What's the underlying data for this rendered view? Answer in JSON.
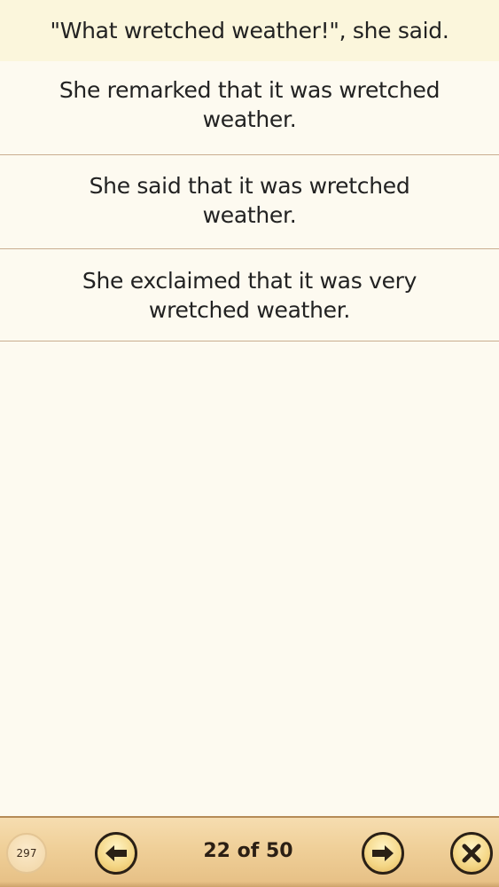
{
  "question": {
    "text": "\"What wretched weather!\", she said."
  },
  "options": [
    {
      "text": "She remarked that it was wretched weather."
    },
    {
      "text": "She said that it was wretched weather."
    },
    {
      "text": "She exclaimed that it was very wretched weather."
    }
  ],
  "toolbar": {
    "score": "297",
    "counter": "22 of 50",
    "prev_icon": "arrow-left-icon",
    "next_icon": "arrow-right-icon",
    "close_icon": "close-icon"
  },
  "colors": {
    "background": "#fdfaf0",
    "question_bg": "#fbf6dc",
    "divider": "#c9ad90",
    "toolbar": "#efcf98",
    "button_fill": "#f4d685"
  }
}
